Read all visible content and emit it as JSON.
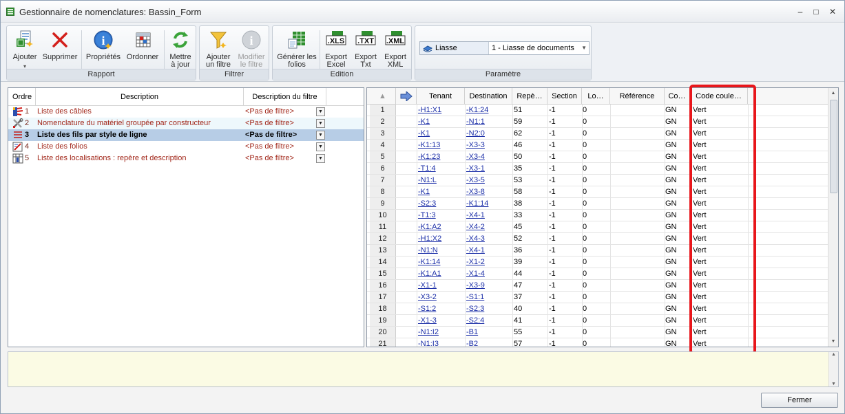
{
  "window": {
    "title": "Gestionnaire de nomenclatures: Bassin_Form",
    "controls": {
      "minimize": "–",
      "maximize": "□",
      "close": "✕"
    }
  },
  "ribbon": {
    "rapport": {
      "label": "Rapport",
      "buttons": [
        {
          "label1": "Ajouter",
          "label2": "",
          "icon": "add-report-icon"
        },
        {
          "label1": "Supprimer",
          "label2": "",
          "icon": "delete-x-icon"
        },
        {
          "label1": "Propriétés",
          "label2": "",
          "icon": "info-icon"
        },
        {
          "label1": "Ordonner",
          "label2": "",
          "icon": "order-grid-icon"
        },
        {
          "label1": "Mettre",
          "label2": "à jour",
          "icon": "refresh-icon"
        }
      ]
    },
    "filtrer": {
      "label": "Filtrer",
      "buttons": [
        {
          "label1": "Ajouter",
          "label2": "un filtre",
          "icon": "funnel-icon"
        },
        {
          "label1": "Modifier",
          "label2": "le filtre",
          "icon": "info-disabled-icon"
        }
      ]
    },
    "edition": {
      "label": "Edition",
      "buttons": [
        {
          "label1": "Générer les",
          "label2": "folios",
          "icon": "generate-sheets-icon"
        },
        {
          "label1": "Export",
          "label2": "Excel",
          "icon": "xls-icon",
          "badge": "XLS"
        },
        {
          "label1": "Export",
          "label2": "Txt",
          "icon": "txt-icon",
          "badge": "TXT"
        },
        {
          "label1": "Export",
          "label2": "XML",
          "icon": "xml-icon",
          "badge": "XML"
        }
      ]
    },
    "parametre": {
      "label": "Paramètre",
      "liasse_label": "Liasse",
      "liasse_value": "1 - Liasse de documents"
    }
  },
  "reports": {
    "headers": {
      "ordre": "Ordre",
      "description": "Description",
      "filtre": "Description du filtre"
    },
    "rows": [
      {
        "ordre": "1",
        "description": "Liste des câbles",
        "filtre": "<Pas de filtre>",
        "icon": "cable-list-icon"
      },
      {
        "ordre": "2",
        "description": "Nomenclature du matériel groupée par constructeur",
        "filtre": "<Pas de filtre>",
        "icon": "tools-icon"
      },
      {
        "ordre": "3",
        "description": "Liste des fils par style de ligne",
        "filtre": "<Pas de filtre>",
        "icon": "line-style-icon"
      },
      {
        "ordre": "4",
        "description": "Liste des folios",
        "filtre": "<Pas de filtre>",
        "icon": "folio-icon"
      },
      {
        "ordre": "5",
        "description": "Liste des localisations : repère et description",
        "filtre": "<Pas de filtre>",
        "icon": "location-icon"
      }
    ]
  },
  "grid": {
    "headers": {
      "tenant": "Tenant",
      "destination": "Destination",
      "repere": "Repè…",
      "section": "Section",
      "lo": "Lo…",
      "reference": "Référence",
      "co": "Co…",
      "code_couleur": "Code coule…"
    },
    "rows": [
      {
        "n": "1",
        "tenant": "-H1:X1",
        "dest": "-K1:24",
        "rep": "51",
        "sec": "-1",
        "lo": "0",
        "co": "GN",
        "code": "Vert"
      },
      {
        "n": "2",
        "tenant": "-K1",
        "dest": "-N1:1",
        "rep": "59",
        "sec": "-1",
        "lo": "0",
        "co": "GN",
        "code": "Vert"
      },
      {
        "n": "3",
        "tenant": "-K1",
        "dest": "-N2:0",
        "rep": "62",
        "sec": "-1",
        "lo": "0",
        "co": "GN",
        "code": "Vert"
      },
      {
        "n": "4",
        "tenant": "-K1:13",
        "dest": "-X3-3",
        "rep": "46",
        "sec": "-1",
        "lo": "0",
        "co": "GN",
        "code": "Vert"
      },
      {
        "n": "5",
        "tenant": "-K1:23",
        "dest": "-X3-4",
        "rep": "50",
        "sec": "-1",
        "lo": "0",
        "co": "GN",
        "code": "Vert"
      },
      {
        "n": "6",
        "tenant": "-T1:4",
        "dest": "-X3-1",
        "rep": "35",
        "sec": "-1",
        "lo": "0",
        "co": "GN",
        "code": "Vert"
      },
      {
        "n": "7",
        "tenant": "-N1:L",
        "dest": "-X3-5",
        "rep": "53",
        "sec": "-1",
        "lo": "0",
        "co": "GN",
        "code": "Vert"
      },
      {
        "n": "8",
        "tenant": "-K1",
        "dest": "-X3-8",
        "rep": "58",
        "sec": "-1",
        "lo": "0",
        "co": "GN",
        "code": "Vert"
      },
      {
        "n": "9",
        "tenant": "-S2:3",
        "dest": "-K1:14",
        "rep": "38",
        "sec": "-1",
        "lo": "0",
        "co": "GN",
        "code": "Vert"
      },
      {
        "n": "10",
        "tenant": "-T1:3",
        "dest": "-X4-1",
        "rep": "33",
        "sec": "-1",
        "lo": "0",
        "co": "GN",
        "code": "Vert"
      },
      {
        "n": "11",
        "tenant": "-K1:A2",
        "dest": "-X4-2",
        "rep": "45",
        "sec": "-1",
        "lo": "0",
        "co": "GN",
        "code": "Vert"
      },
      {
        "n": "12",
        "tenant": "-H1:X2",
        "dest": "-X4-3",
        "rep": "52",
        "sec": "-1",
        "lo": "0",
        "co": "GN",
        "code": "Vert"
      },
      {
        "n": "13",
        "tenant": "-N1:N",
        "dest": "-X4-1",
        "rep": "36",
        "sec": "-1",
        "lo": "0",
        "co": "GN",
        "code": "Vert"
      },
      {
        "n": "14",
        "tenant": "-K1:14",
        "dest": "-X1-2",
        "rep": "39",
        "sec": "-1",
        "lo": "0",
        "co": "GN",
        "code": "Vert"
      },
      {
        "n": "15",
        "tenant": "-K1:A1",
        "dest": "-X1-4",
        "rep": "44",
        "sec": "-1",
        "lo": "0",
        "co": "GN",
        "code": "Vert"
      },
      {
        "n": "16",
        "tenant": "-X1-1",
        "dest": "-X3-9",
        "rep": "47",
        "sec": "-1",
        "lo": "0",
        "co": "GN",
        "code": "Vert"
      },
      {
        "n": "17",
        "tenant": "-X3-2",
        "dest": "-S1:1",
        "rep": "37",
        "sec": "-1",
        "lo": "0",
        "co": "GN",
        "code": "Vert"
      },
      {
        "n": "18",
        "tenant": "-S1:2",
        "dest": "-S2:3",
        "rep": "40",
        "sec": "-1",
        "lo": "0",
        "co": "GN",
        "code": "Vert"
      },
      {
        "n": "19",
        "tenant": "-X1-3",
        "dest": "-S2:4",
        "rep": "41",
        "sec": "-1",
        "lo": "0",
        "co": "GN",
        "code": "Vert"
      },
      {
        "n": "20",
        "tenant": "-N1:I2",
        "dest": "-B1",
        "rep": "55",
        "sec": "-1",
        "lo": "0",
        "co": "GN",
        "code": "Vert"
      },
      {
        "n": "21",
        "tenant": "-N1:I3",
        "dest": "-B2",
        "rep": "57",
        "sec": "-1",
        "lo": "0",
        "co": "GN",
        "code": "Vert"
      }
    ]
  },
  "footer": {
    "close_label": "Fermer"
  },
  "colors": {
    "highlight": "#e8161b",
    "link": "#1c2fa8",
    "report_text": "#a2281b",
    "selected_row": "#b7cde6",
    "notes_bg": "#fbfbe4"
  }
}
